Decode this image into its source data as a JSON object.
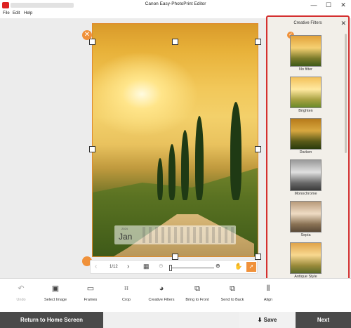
{
  "window": {
    "title": "Canon Easy-PhotoPrint Editor",
    "minimize": "—",
    "maximize": "☐",
    "close": "✕"
  },
  "menu": {
    "items": [
      "File",
      "Edit",
      "Help"
    ]
  },
  "calendar": {
    "year": "2024",
    "month": "Jan"
  },
  "pager": {
    "count": "1/12"
  },
  "panel": {
    "title": "Creative Filters",
    "close": "✕",
    "filters": [
      {
        "label": "No filter",
        "selected": true
      },
      {
        "label": "Brighten",
        "selected": false
      },
      {
        "label": "Darken",
        "selected": false
      },
      {
        "label": "Monochrome",
        "selected": false
      },
      {
        "label": "Sepia",
        "selected": false
      },
      {
        "label": "Antique Style",
        "selected": false
      }
    ]
  },
  "toolbar": {
    "undo": "Undo",
    "select_image": "Select Image",
    "frames": "Frames",
    "crop": "Crop",
    "creative_filters": "Creative Filters",
    "bring_to_front": "Bring to Front",
    "send_to_back": "Send to Back",
    "align": "Align"
  },
  "footer": {
    "home": "Return to Home Screen",
    "save": "Save",
    "next": "Next"
  },
  "colors": {
    "accent": "#f0913a",
    "highlight_border": "#d43030",
    "footer_bg": "#4a4a4a"
  }
}
